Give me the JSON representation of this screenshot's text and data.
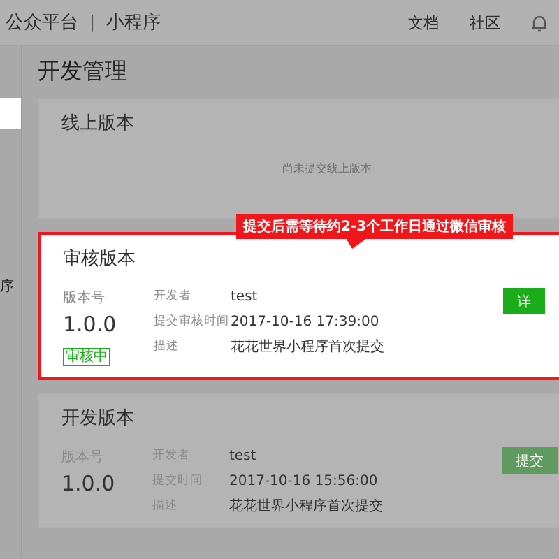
{
  "header": {
    "title": "公众平台",
    "separator": "|",
    "subtitle": "小程序",
    "links": [
      "文档",
      "社区"
    ]
  },
  "sidebar": {
    "items": [
      {
        "selected": true
      },
      {
        "label": "序",
        "selected": false
      }
    ]
  },
  "page_title": "开发管理",
  "tooltip": "提交后需等待约2-3个工作日通过微信审核",
  "cards": [
    {
      "title": "线上版本",
      "highlighted": false,
      "empty_text": "尚未提交线上版本"
    },
    {
      "title": "审核版本",
      "highlighted": true,
      "version_label": "版本号",
      "version": "1.0.0",
      "status": "审核中",
      "fields": [
        {
          "label": "开发者",
          "value": "test"
        },
        {
          "label": "提交审核时间",
          "value": "2017-10-16 17:39:00"
        },
        {
          "label": "描述",
          "value": "花花世界小程序首次提交"
        }
      ],
      "button": {
        "label": "详",
        "disabled": false
      }
    },
    {
      "title": "开发版本",
      "highlighted": false,
      "version_label": "版本号",
      "version": "1.0.0",
      "fields": [
        {
          "label": "开发者",
          "value": "test"
        },
        {
          "label": "提交时间",
          "value": "2017-10-16 15:56:00"
        },
        {
          "label": "描述",
          "value": "花花世界小程序首次提交"
        }
      ],
      "button": {
        "label": "提交",
        "disabled": true
      }
    }
  ]
}
